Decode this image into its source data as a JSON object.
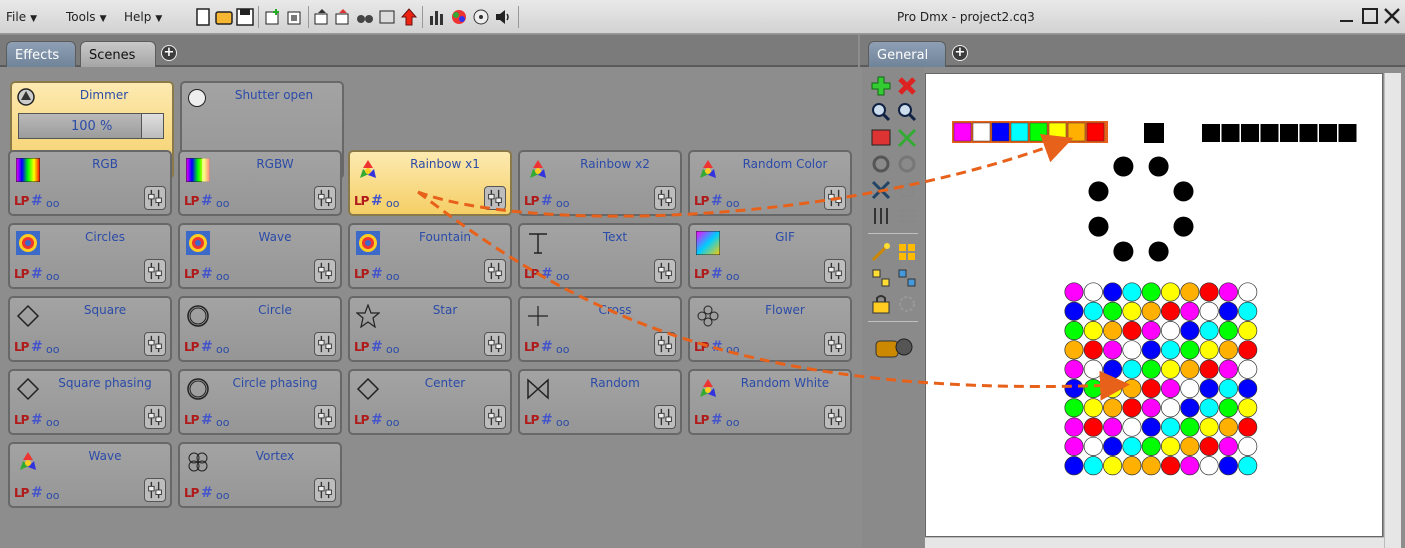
{
  "menu": {
    "file": "File",
    "tools": "Tools",
    "help": "Help"
  },
  "window": {
    "title": "Pro Dmx - project2.cq3"
  },
  "left_tabs": {
    "effects": "Effects",
    "scenes": "Scenes"
  },
  "right_tabs": {
    "general": "General"
  },
  "dimmer": {
    "label": "Dimmer",
    "value": "100 %"
  },
  "shutter": {
    "label": "Shutter open"
  },
  "effect_tag": {
    "lp": "LP",
    "hash": "#",
    "oo": "oo"
  },
  "effects": [
    {
      "label": "RGB",
      "icon": "rgb-gradient-icon"
    },
    {
      "label": "RGBW",
      "icon": "rgbw-gradient-icon"
    },
    {
      "label": "Rainbow x1",
      "icon": "recycle-icon",
      "selected": true
    },
    {
      "label": "Rainbow x2",
      "icon": "recycle-icon"
    },
    {
      "label": "Random Color",
      "icon": "recycle-icon"
    },
    {
      "label": "Circles",
      "icon": "target-icon"
    },
    {
      "label": "Wave",
      "icon": "target-icon"
    },
    {
      "label": "Fountain",
      "icon": "target-icon"
    },
    {
      "label": "Text",
      "icon": "text-t-icon"
    },
    {
      "label": "GIF",
      "icon": "swirl-icon"
    },
    {
      "label": "Square",
      "icon": "diamond-icon"
    },
    {
      "label": "Circle",
      "icon": "ring-icon"
    },
    {
      "label": "Star",
      "icon": "star-icon"
    },
    {
      "label": "Cross",
      "icon": "cross-icon"
    },
    {
      "label": "Flower",
      "icon": "flower-icon"
    },
    {
      "label": "Square phasing",
      "icon": "diamond-icon"
    },
    {
      "label": "Circle phasing",
      "icon": "ring-icon"
    },
    {
      "label": "Center",
      "icon": "diamond-icon"
    },
    {
      "label": "Random",
      "icon": "bowtie-icon"
    },
    {
      "label": "Random White",
      "icon": "recycle-icon"
    },
    {
      "label": "Wave",
      "icon": "recycle-icon"
    },
    {
      "label": "Vortex",
      "icon": "knot-icon"
    }
  ],
  "colors": {
    "accent_arrow": "#e8611a",
    "label_blue": "#2b4ba8",
    "selected_bg": "#f5cf66"
  },
  "canvas": {
    "strip_colors": [
      "#ff00ff",
      "#ffffff",
      "#0000ff",
      "#00ffff",
      "#00ff00",
      "#ffff00",
      "#ffb000",
      "#ff0000"
    ],
    "grid_colors": [
      [
        "#ff00ff",
        "#ffffff",
        "#0000ff",
        "#00ffff",
        "#00ff00",
        "#ffff00",
        "#ffb000",
        "#ff0000",
        "#ff00ff",
        "#ffffff"
      ],
      [
        "#0000ff",
        "#00ffff",
        "#00ff00",
        "#ffff00",
        "#ffb000",
        "#ff0000",
        "#ff00ff",
        "#ffffff",
        "#0000ff",
        "#00ffff"
      ],
      [
        "#00ff00",
        "#ffff00",
        "#ffb000",
        "#ff0000",
        "#ff00ff",
        "#ffffff",
        "#0000ff",
        "#00ffff",
        "#00ff00",
        "#ffff00"
      ],
      [
        "#ffb000",
        "#ff0000",
        "#ff00ff",
        "#ffffff",
        "#0000ff",
        "#00ffff",
        "#00ff00",
        "#ffff00",
        "#ffb000",
        "#ff0000"
      ],
      [
        "#ff00ff",
        "#ffffff",
        "#0000ff",
        "#00ffff",
        "#00ff00",
        "#ffff00",
        "#ffb000",
        "#ff0000",
        "#ff00ff",
        "#ffffff"
      ],
      [
        "#0000ff",
        "#00ff00",
        "#ffff00",
        "#ffb000",
        "#ff0000",
        "#ff00ff",
        "#ffffff",
        "#0000ff",
        "#00ffff",
        "#0000ff"
      ],
      [
        "#00ff00",
        "#ffff00",
        "#ffb000",
        "#ff0000",
        "#ff00ff",
        "#ffffff",
        "#0000ff",
        "#00ffff",
        "#00ff00",
        "#ffff00"
      ],
      [
        "#ff00ff",
        "#ff0000",
        "#ff00ff",
        "#ffffff",
        "#0000ff",
        "#00ffff",
        "#00ff00",
        "#ffff00",
        "#ffb000",
        "#ff0000"
      ],
      [
        "#ff00ff",
        "#ffffff",
        "#0000ff",
        "#00ffff",
        "#00ff00",
        "#ffff00",
        "#ffb000",
        "#ff0000",
        "#ff00ff",
        "#ffffff"
      ],
      [
        "#0000ff",
        "#00ffff",
        "#ffff00",
        "#ffb000",
        "#ffb000",
        "#ff0000",
        "#ff00ff",
        "#ffffff",
        "#0000ff",
        "#00ffff"
      ]
    ]
  }
}
